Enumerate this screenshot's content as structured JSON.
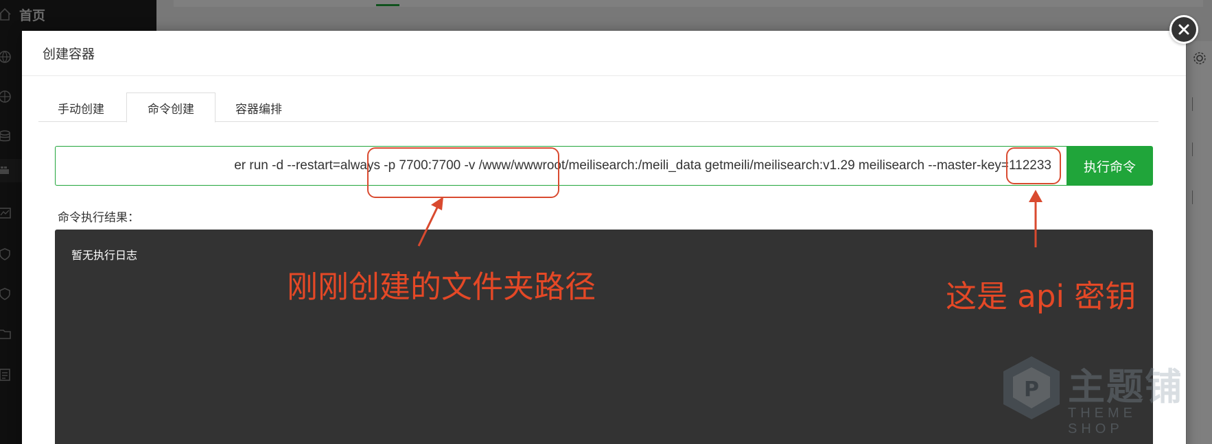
{
  "background": {
    "sidebar_home_label": "首页"
  },
  "modal": {
    "title": "创建容器",
    "tabs": [
      {
        "label": "手动创建",
        "active": false
      },
      {
        "label": "命令创建",
        "active": true
      },
      {
        "label": "容器编排",
        "active": false
      }
    ],
    "command_value": "er run -d --restart=always -p 7700:7700 -v /www/wwwroot/meilisearch:/meili_data getmeili/meilisearch:v1.29 meilisearch --master-key=112233",
    "run_button_label": "执行命令",
    "result_label": "命令执行结果：",
    "log_text": "暂无执行日志"
  },
  "annotations": {
    "path_note": "刚刚创建的文件夹路径",
    "key_note": "这是 api 密钥",
    "color": "#e44826"
  },
  "watermark": {
    "text": "主题铺",
    "subtext": "THEME SHOP"
  },
  "colors": {
    "accent": "#20a53a",
    "log_bg": "#333333"
  }
}
